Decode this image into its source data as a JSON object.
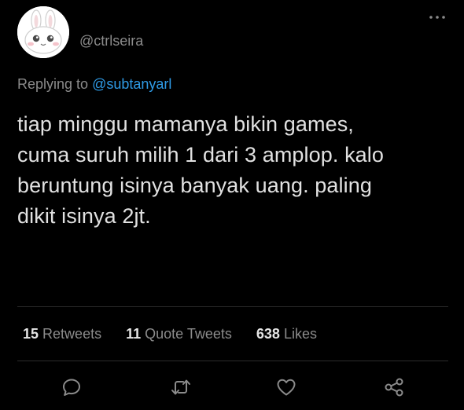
{
  "tweet": {
    "author_handle": "@ctrlseira",
    "avatar_icon": "bunny-face-icon",
    "more_icon": "more-dots-icon",
    "replying_prefix": "Replying to",
    "replying_to": "@subtanyarl",
    "text_lines": [
      "tiap minggu mamanya bikin games,",
      "cuma suruh milih 1 dari 3 amplop. kalo",
      "beruntung isinya banyak uang. paling",
      "dikit isinya 2jt."
    ]
  },
  "stats": {
    "retweets": {
      "count": "15",
      "label": "Retweets"
    },
    "quote_tweets": {
      "count": "11",
      "label": "Quote Tweets"
    },
    "likes": {
      "count": "638",
      "label": "Likes"
    }
  },
  "actions": {
    "reply_icon": "reply-bubble-icon",
    "retweet_icon": "retweet-icon",
    "like_icon": "heart-icon",
    "share_icon": "share-icon"
  },
  "colors": {
    "background": "#000000",
    "muted_text": "#8b8b8b",
    "accent_link": "#2f9be6",
    "body_text": "#e1e1e1",
    "divider": "#2b2b2b"
  }
}
